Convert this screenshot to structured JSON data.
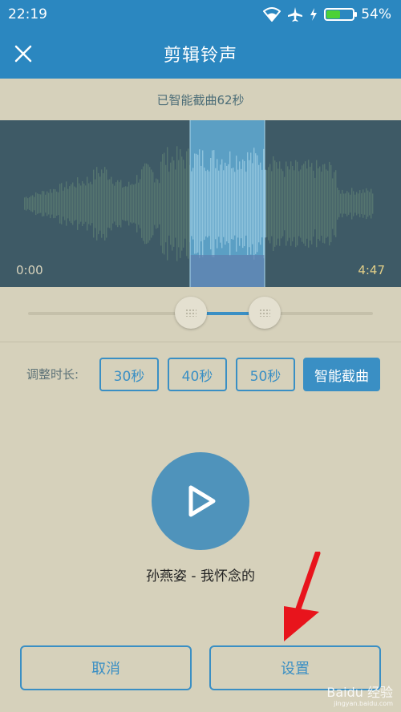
{
  "status_bar": {
    "time": "22:19",
    "battery_text": "54%",
    "battery_level": 0.54
  },
  "header": {
    "title": "剪辑铃声"
  },
  "smart_label": "已智能截曲62秒",
  "waveform": {
    "start_time": "0:00",
    "end_time": "4:47"
  },
  "adjust": {
    "label": "调整时长:",
    "buttons": [
      "30秒",
      "40秒",
      "50秒",
      "智能截曲"
    ],
    "selected": "智能截曲"
  },
  "player": {
    "song": "孙燕姿 - 我怀念的"
  },
  "actions": {
    "cancel": "取消",
    "set": "设置"
  },
  "watermark": {
    "brand": "Baidu 经验",
    "url": "jingyan.baidu.com"
  },
  "colors": {
    "header_bg": "#2b87c0",
    "accent": "#3a8fc4",
    "page_bg": "#d6d1bb",
    "waveform_bg": "#3e5a66",
    "selection": "#5b9fc4",
    "arrow": "#e8141c"
  }
}
